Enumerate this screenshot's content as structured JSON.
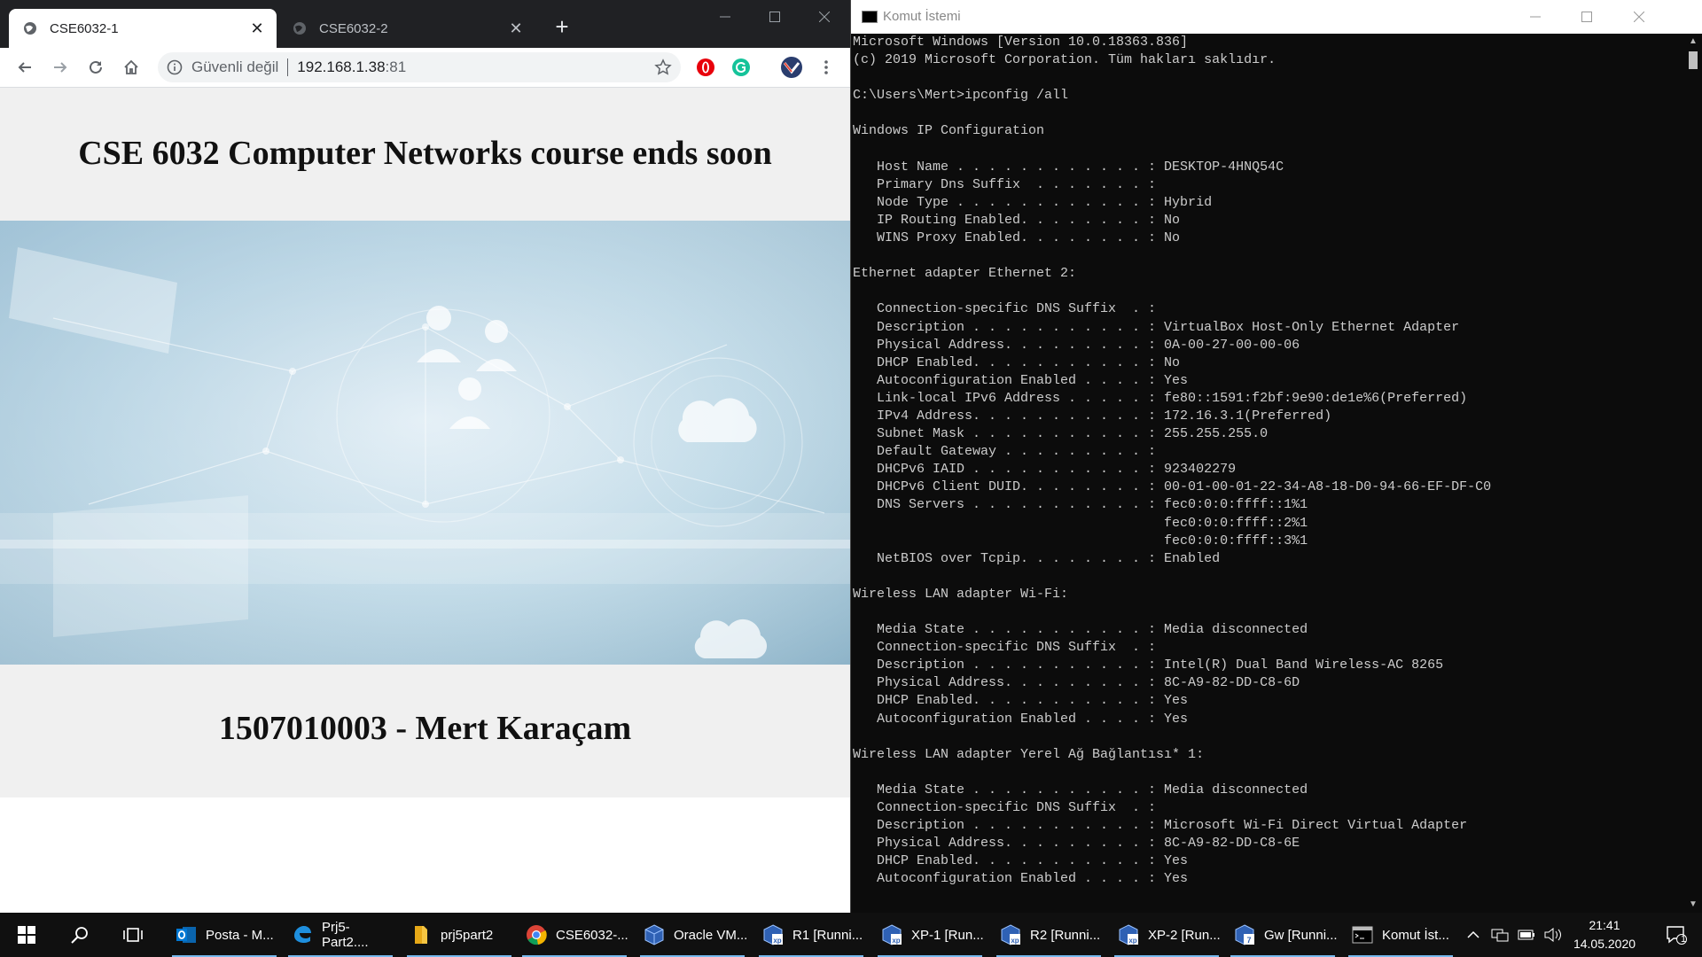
{
  "browser": {
    "tabs": [
      {
        "title": "CSE6032-1",
        "active": true
      },
      {
        "title": "CSE6032-2",
        "active": false
      }
    ],
    "address": {
      "security_label": "Güvenli değil",
      "host": "192.168.1.38",
      "port": ":81"
    },
    "page": {
      "heading": "CSE 6032 Computer Networks course ends soon",
      "footer_heading": "1507010003 - Mert Karaçam"
    }
  },
  "console": {
    "title": "Komut İstemi",
    "lines": [
      "Microsoft Windows [Version 10.0.18363.836]",
      "(c) 2019 Microsoft Corporation. Tüm hakları saklıdır.",
      "",
      "C:\\Users\\Mert>ipconfig /all",
      "",
      "Windows IP Configuration",
      "",
      "   Host Name . . . . . . . . . . . . : DESKTOP-4HNQ54C",
      "   Primary Dns Suffix  . . . . . . . :",
      "   Node Type . . . . . . . . . . . . : Hybrid",
      "   IP Routing Enabled. . . . . . . . : No",
      "   WINS Proxy Enabled. . . . . . . . : No",
      "",
      "Ethernet adapter Ethernet 2:",
      "",
      "   Connection-specific DNS Suffix  . :",
      "   Description . . . . . . . . . . . : VirtualBox Host-Only Ethernet Adapter",
      "   Physical Address. . . . . . . . . : 0A-00-27-00-00-06",
      "   DHCP Enabled. . . . . . . . . . . : No",
      "   Autoconfiguration Enabled . . . . : Yes",
      "   Link-local IPv6 Address . . . . . : fe80::1591:f2bf:9e90:de1e%6(Preferred)",
      "   IPv4 Address. . . . . . . . . . . : 172.16.3.1(Preferred)",
      "   Subnet Mask . . . . . . . . . . . : 255.255.255.0",
      "   Default Gateway . . . . . . . . . :",
      "   DHCPv6 IAID . . . . . . . . . . . : 923402279",
      "   DHCPv6 Client DUID. . . . . . . . : 00-01-00-01-22-34-A8-18-D0-94-66-EF-DF-C0",
      "   DNS Servers . . . . . . . . . . . : fec0:0:0:ffff::1%1",
      "                                       fec0:0:0:ffff::2%1",
      "                                       fec0:0:0:ffff::3%1",
      "   NetBIOS over Tcpip. . . . . . . . : Enabled",
      "",
      "Wireless LAN adapter Wi-Fi:",
      "",
      "   Media State . . . . . . . . . . . : Media disconnected",
      "   Connection-specific DNS Suffix  . :",
      "   Description . . . . . . . . . . . : Intel(R) Dual Band Wireless-AC 8265",
      "   Physical Address. . . . . . . . . : 8C-A9-82-DD-C8-6D",
      "   DHCP Enabled. . . . . . . . . . . : Yes",
      "   Autoconfiguration Enabled . . . . : Yes",
      "",
      "Wireless LAN adapter Yerel Ağ Bağlantısı* 1:",
      "",
      "   Media State . . . . . . . . . . . : Media disconnected",
      "   Connection-specific DNS Suffix  . :",
      "   Description . . . . . . . . . . . : Microsoft Wi-Fi Direct Virtual Adapter",
      "   Physical Address. . . . . . . . . : 8C-A9-82-DD-C8-6E",
      "   DHCP Enabled. . . . . . . . . . . : Yes",
      "   Autoconfiguration Enabled . . . . : Yes"
    ]
  },
  "taskbar": {
    "apps": [
      {
        "label": "Posta - M...",
        "icon": "outlook-icon"
      },
      {
        "label": "Prj5-Part2....",
        "icon": "edge-icon"
      },
      {
        "label": "prj5part2",
        "icon": "folder-icon"
      },
      {
        "label": "CSE6032-...",
        "icon": "chrome-icon"
      },
      {
        "label": "Oracle VM...",
        "icon": "virtualbox-icon"
      },
      {
        "label": "R1 [Runni...",
        "icon": "vm-xp-icon"
      },
      {
        "label": "XP-1 [Run...",
        "icon": "vm-xp-icon"
      },
      {
        "label": "R2 [Runni...",
        "icon": "vm-xp-icon"
      },
      {
        "label": "XP-2 [Run...",
        "icon": "vm-xp-icon"
      },
      {
        "label": "Gw [Runni...",
        "icon": "vm-7-icon"
      },
      {
        "label": "Komut İst...",
        "icon": "cmd-icon"
      }
    ],
    "time": "21:41",
    "date": "14.05.2020",
    "notification_count": "1"
  },
  "colors": {
    "chrome_frame": "#202124",
    "console_bg": "#0c0c0c",
    "console_text": "#cccccc",
    "taskbar_bg": "#101010",
    "taskbar_active_underline": "#76b9ed"
  }
}
